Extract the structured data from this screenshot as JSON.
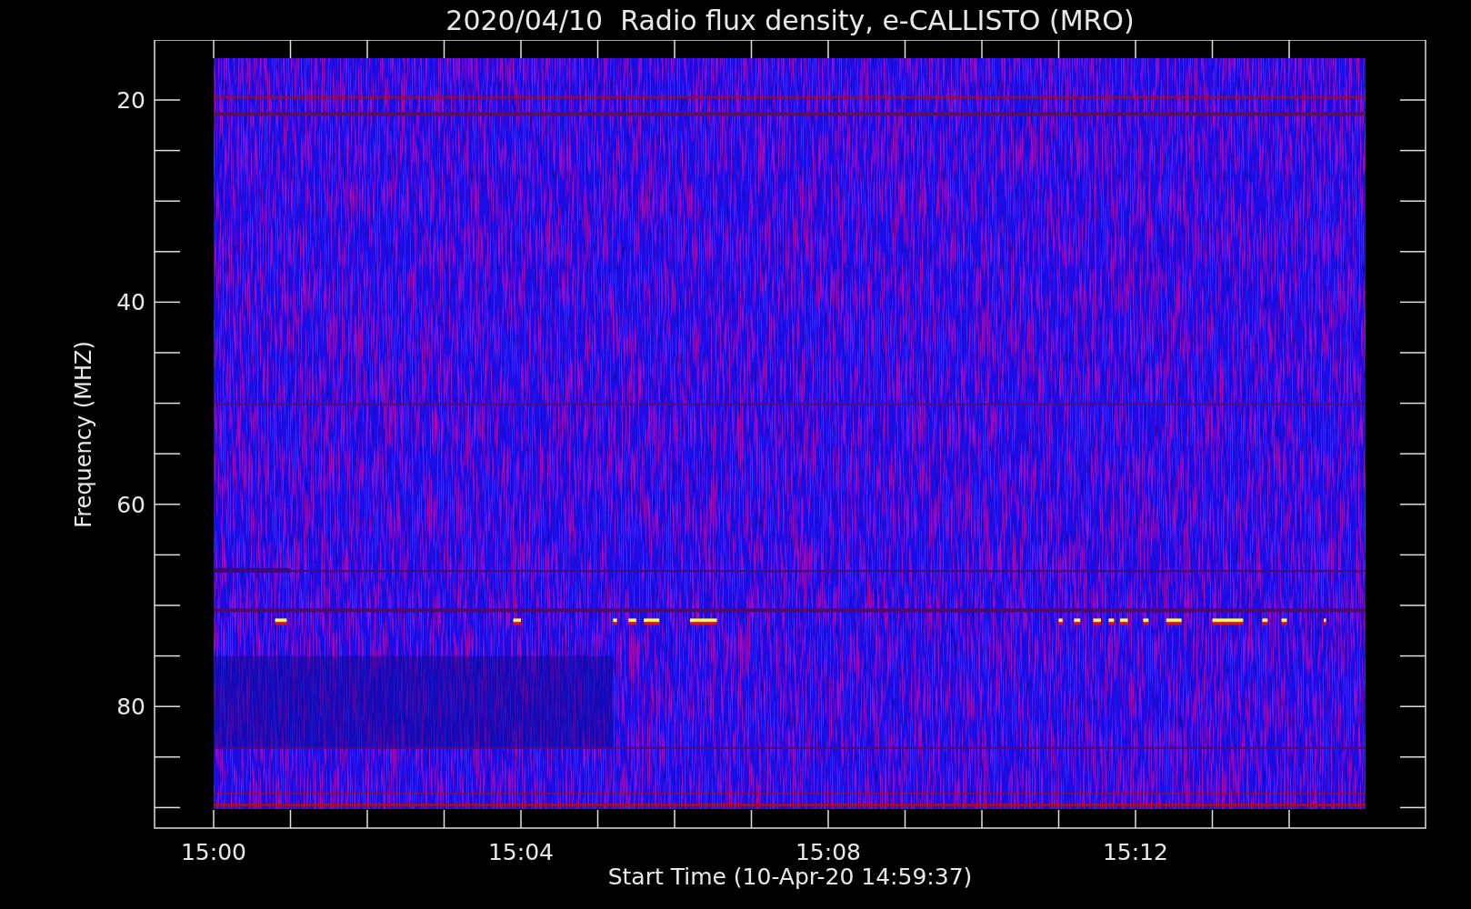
{
  "plot": {
    "title": "2020/04/10  Radio flux density, e-CALLISTO (MRO)",
    "ylabel": "Frequency (MHZ)",
    "xlabel": "Start Time (10-Apr-20 14:59:37)",
    "yticks": [
      "20",
      "40",
      "60",
      "80"
    ],
    "xticks": [
      "15:00",
      "15:04",
      "15:08",
      "15:12"
    ]
  }
}
